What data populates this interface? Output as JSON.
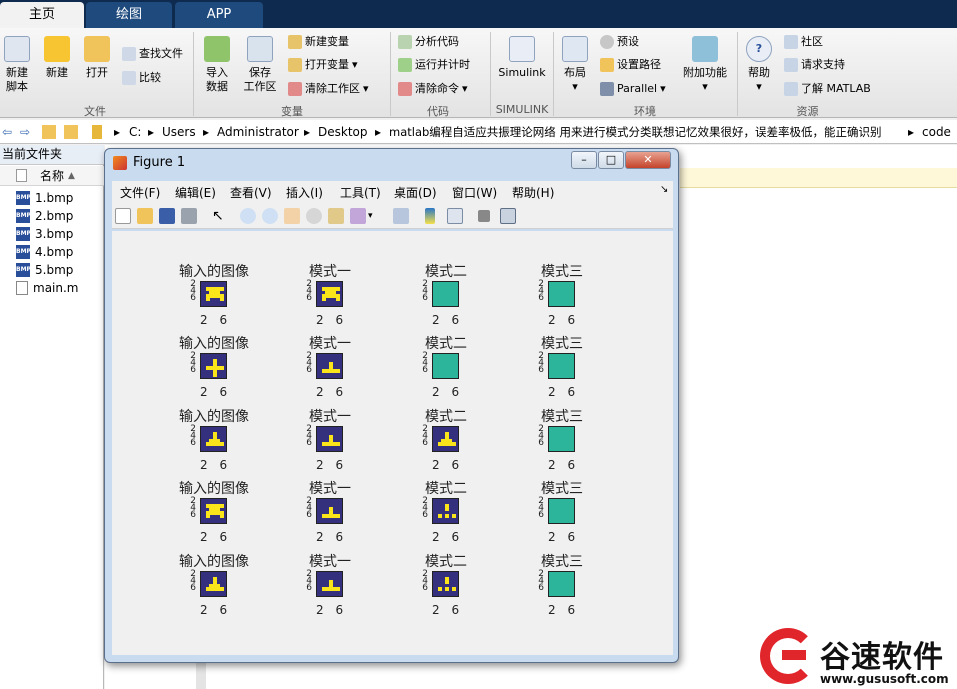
{
  "tabs": [
    "主页",
    "绘图",
    "APP"
  ],
  "ribbon": {
    "file_group": {
      "label": "文件",
      "new_script": "新建\n脚本",
      "new": "新建",
      "open": "打开",
      "find_files": "查找文件",
      "compare": "比较"
    },
    "variable_group": {
      "label": "变量",
      "import": "导入\n数据",
      "save_ws": "保存\n工作区",
      "new_var": "新建变量",
      "open_var": "打开变量",
      "clear_ws": "清除工作区"
    },
    "code_group": {
      "label": "代码",
      "analyze": "分析代码",
      "run_time": "运行并计时",
      "clear_cmd": "清除命令"
    },
    "simulink_group": {
      "label": "SIMULINK",
      "simulink": "Simulink"
    },
    "env_group": {
      "label": "环境",
      "layout": "布局",
      "prefs": "预设",
      "set_path": "设置路径",
      "parallel": "Parallel",
      "addons": "附加功能"
    },
    "resources_group": {
      "label": "资源",
      "help": "帮助",
      "community": "社区",
      "support": "请求支持",
      "learn": "了解 MATLAB"
    }
  },
  "address": [
    "C:",
    "Users",
    "Administrator",
    "Desktop",
    "matlab编程自适应共振理论网络 用来进行模式分类联想记忆效果很好，误差率极低，能正确识别",
    "code"
  ],
  "left_panel": {
    "title": "当前文件夹",
    "col_name": "名称",
    "files": [
      "1.bmp",
      "2.bmp",
      "3.bmp",
      "4.bmp",
      "5.bmp",
      "main.m"
    ]
  },
  "figure": {
    "title": "Figure 1",
    "menus": [
      "文件(F)",
      "编辑(E)",
      "查看(V)",
      "插入(I)",
      "工具(T)",
      "桌面(D)",
      "窗口(W)",
      "帮助(H)"
    ],
    "col_titles": [
      "输入的图像",
      "模式一",
      "模式二",
      "模式三"
    ],
    "yticks": [
      "2",
      "4",
      "6"
    ],
    "xticks": "2 6",
    "pattern_grid": [
      [
        "A",
        "A",
        "T",
        "T"
      ],
      [
        "P",
        "B",
        "T",
        "T"
      ],
      [
        "C",
        "B",
        "C",
        "T"
      ],
      [
        "A",
        "B",
        "D",
        "T"
      ],
      [
        "C",
        "B",
        "D",
        "T"
      ]
    ],
    "pattern_legend": {
      "A": "alien shape",
      "B": "small T",
      "C": "filled T",
      "D": "dotted T",
      "P": "plus",
      "T": "blank (teal)"
    }
  },
  "watermark": {
    "brand": "谷速软件",
    "url": "www.gususoft.com"
  },
  "colors": {
    "navy": "#35307e",
    "yellow": "#f9e51a",
    "teal": "#2db59b",
    "tab_dark": "#0f2a4f"
  }
}
